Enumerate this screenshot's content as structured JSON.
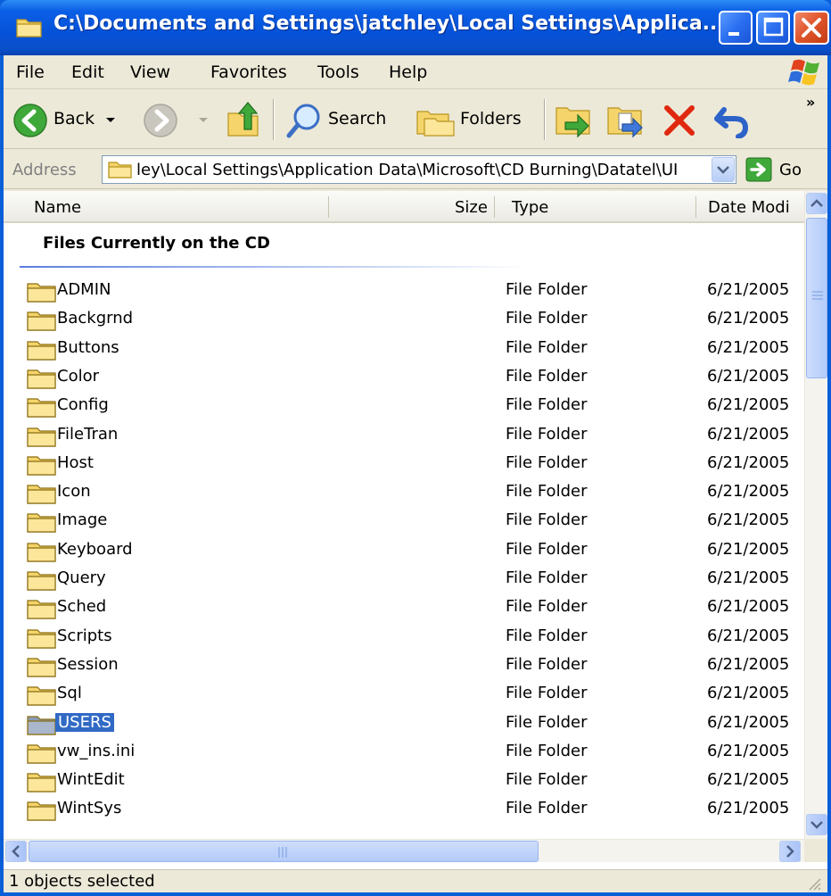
{
  "window": {
    "title": "C:\\Documents and Settings\\jatchley\\Local Settings\\Applica..."
  },
  "menu": [
    "File",
    "Edit",
    "View",
    "Favorites",
    "Tools",
    "Help"
  ],
  "toolbar": {
    "back_label": "Back",
    "search_label": "Search",
    "folders_label": "Folders",
    "chevron": "»"
  },
  "address": {
    "label": "Address",
    "value": "ley\\Local Settings\\Application Data\\Microsoft\\CD Burning\\Datatel\\UI",
    "go_label": "Go"
  },
  "columns": {
    "name": "Name",
    "size": "Size",
    "type": "Type",
    "date": "Date Modi"
  },
  "group_title": "Files Currently on the CD",
  "files": [
    {
      "name": "ADMIN",
      "type": "File Folder",
      "date": "6/21/2005"
    },
    {
      "name": "Backgrnd",
      "type": "File Folder",
      "date": "6/21/2005"
    },
    {
      "name": "Buttons",
      "type": "File Folder",
      "date": "6/21/2005"
    },
    {
      "name": "Color",
      "type": "File Folder",
      "date": "6/21/2005"
    },
    {
      "name": "Config",
      "type": "File Folder",
      "date": "6/21/2005"
    },
    {
      "name": "FileTran",
      "type": "File Folder",
      "date": "6/21/2005"
    },
    {
      "name": "Host",
      "type": "File Folder",
      "date": "6/21/2005"
    },
    {
      "name": "Icon",
      "type": "File Folder",
      "date": "6/21/2005"
    },
    {
      "name": "Image",
      "type": "File Folder",
      "date": "6/21/2005"
    },
    {
      "name": "Keyboard",
      "type": "File Folder",
      "date": "6/21/2005"
    },
    {
      "name": "Query",
      "type": "File Folder",
      "date": "6/21/2005"
    },
    {
      "name": "Sched",
      "type": "File Folder",
      "date": "6/21/2005"
    },
    {
      "name": "Scripts",
      "type": "File Folder",
      "date": "6/21/2005"
    },
    {
      "name": "Session",
      "type": "File Folder",
      "date": "6/21/2005"
    },
    {
      "name": "Sql",
      "type": "File Folder",
      "date": "6/21/2005"
    },
    {
      "name": "USERS",
      "type": "File Folder",
      "date": "6/21/2005",
      "selected": true
    },
    {
      "name": "vw_ins.ini",
      "type": "File Folder",
      "date": "6/21/2005"
    },
    {
      "name": "WintEdit",
      "type": "File Folder",
      "date": "6/21/2005"
    },
    {
      "name": "WintSys",
      "type": "File Folder",
      "date": "6/21/2005"
    }
  ],
  "status": {
    "text": "1 objects selected"
  },
  "colors": {
    "titlebar": "#0552d8",
    "selection": "#316ac5",
    "chrome": "#ece9d8",
    "folder": "#f5d56b"
  }
}
